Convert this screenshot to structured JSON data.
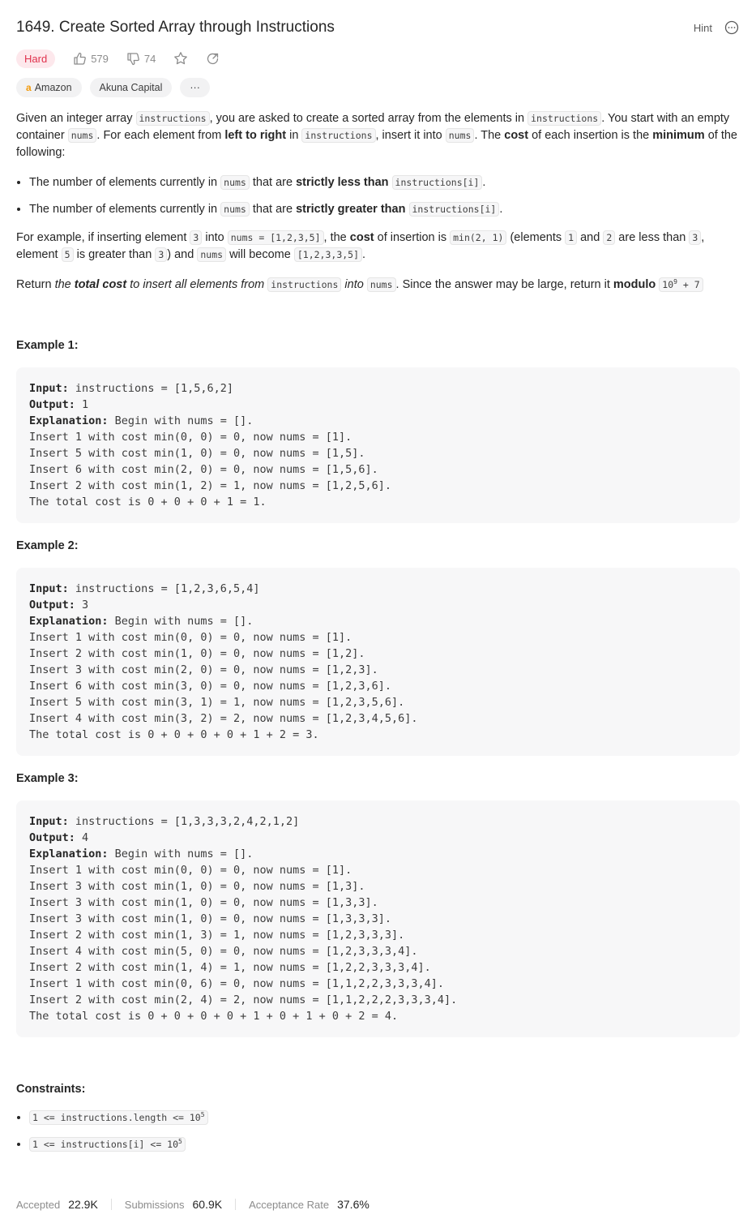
{
  "problem": {
    "title": "1649. Create Sorted Array through Instructions",
    "hint_label": "Hint",
    "difficulty": "Hard",
    "likes": "579",
    "dislikes": "74"
  },
  "tags": {
    "company1": "Amazon",
    "company2": "Akuna Capital",
    "more": "···"
  },
  "description": {
    "p1_a": "Given an integer array ",
    "p1_code1": "instructions",
    "p1_b": ", you are asked to create a sorted array from the elements in ",
    "p1_code2": "instructions",
    "p1_c": ". You start with an empty container ",
    "p1_code3": "nums",
    "p1_d": ". For each element from ",
    "p1_bold1": "left to right",
    "p1_e": " in ",
    "p1_code4": "instructions",
    "p1_f": ", insert it into ",
    "p1_code5": "nums",
    "p1_g": ". The ",
    "p1_bold2": "cost",
    "p1_h": " of each insertion is the ",
    "p1_bold3": "minimum",
    "p1_i": " of the following:",
    "b1_a": "The number of elements currently in ",
    "b1_code1": "nums",
    "b1_b": " that are ",
    "b1_bold": "strictly less than",
    "b1_code2": "instructions[i]",
    "b1_c": ".",
    "b2_a": "The number of elements currently in ",
    "b2_code1": "nums",
    "b2_b": " that are ",
    "b2_bold": "strictly greater than",
    "b2_code2": "instructions[i]",
    "b2_c": ".",
    "p2_a": "For example, if inserting element ",
    "p2_code1": "3",
    "p2_b": " into ",
    "p2_code2": "nums = [1,2,3,5]",
    "p2_c": ", the ",
    "p2_bold": "cost",
    "p2_d": " of insertion is ",
    "p2_code3": "min(2, 1)",
    "p2_e": " (elements ",
    "p2_code4": "1",
    "p2_f": " and ",
    "p2_code5": "2",
    "p2_g": " are less than ",
    "p2_code6": "3",
    "p2_h": ", element ",
    "p2_code7": "5",
    "p2_i": " is greater than ",
    "p2_code8": "3",
    "p2_j": ") and ",
    "p2_code9": "nums",
    "p2_k": " will become ",
    "p2_code10": "[1,2,3,3,5]",
    "p2_l": ".",
    "p3_a": "Return ",
    "p3_i1": "the ",
    "p3_bi": "total cost",
    "p3_i2": " to insert all elements from ",
    "p3_code1": "instructions",
    "p3_i3": " into ",
    "p3_code2": "nums",
    "p3_b": ". Since the answer may be large, return it ",
    "p3_bold": "modulo",
    "p3_code3a": "10",
    "p3_code3sup": "9",
    "p3_code3b": " + 7"
  },
  "examples": [
    {
      "title": "Example 1:",
      "input_label": "Input:",
      "input": " instructions = [1,5,6,2]",
      "output_label": "Output:",
      "output": " 1",
      "explanation_label": "Explanation:",
      "explanation": " Begin with nums = [].\nInsert 1 with cost min(0, 0) = 0, now nums = [1].\nInsert 5 with cost min(1, 0) = 0, now nums = [1,5].\nInsert 6 with cost min(2, 0) = 0, now nums = [1,5,6].\nInsert 2 with cost min(1, 2) = 1, now nums = [1,2,5,6].\nThe total cost is 0 + 0 + 0 + 1 = 1."
    },
    {
      "title": "Example 2:",
      "input_label": "Input:",
      "input": " instructions = [1,2,3,6,5,4]",
      "output_label": "Output:",
      "output": " 3",
      "explanation_label": "Explanation:",
      "explanation": " Begin with nums = [].\nInsert 1 with cost min(0, 0) = 0, now nums = [1].\nInsert 2 with cost min(1, 0) = 0, now nums = [1,2].\nInsert 3 with cost min(2, 0) = 0, now nums = [1,2,3].\nInsert 6 with cost min(3, 0) = 0, now nums = [1,2,3,6].\nInsert 5 with cost min(3, 1) = 1, now nums = [1,2,3,5,6].\nInsert 4 with cost min(3, 2) = 2, now nums = [1,2,3,4,5,6].\nThe total cost is 0 + 0 + 0 + 0 + 1 + 2 = 3."
    },
    {
      "title": "Example 3:",
      "input_label": "Input:",
      "input": " instructions = [1,3,3,3,2,4,2,1,2]",
      "output_label": "Output:",
      "output": " 4",
      "explanation_label": "Explanation:",
      "explanation": " Begin with nums = [].\nInsert 1 with cost min(0, 0) = 0, now nums = [1].\nInsert 3 with cost min(1, 0) = 0, now nums = [1,3].\nInsert 3 with cost min(1, 0) = 0, now nums = [1,3,3].\nInsert 3 with cost min(1, 0) = 0, now nums = [1,3,3,3].\nInsert 2 with cost min(1, 3) = 1, now nums = [1,2,3,3,3].\nInsert 4 with cost min(5, 0) = 0, now nums = [1,2,3,3,3,4].\nInsert 2 with cost min(1, 4) = 1, now nums = [1,2,2,3,3,3,4].\nInsert 1 with cost min(0, 6) = 0, now nums = [1,1,2,2,3,3,3,4].\nInsert 2 with cost min(2, 4) = 2, now nums = [1,1,2,2,2,3,3,3,4].\nThe total cost is 0 + 0 + 0 + 0 + 1 + 0 + 1 + 0 + 2 = 4."
    }
  ],
  "constraints": {
    "title": "Constraints:",
    "c1_a": "1 <= instructions.length <= 10",
    "c1_sup": "5",
    "c2_a": "1 <= instructions[i] <= 10",
    "c2_sup": "5"
  },
  "footer": {
    "accepted_label": "Accepted",
    "accepted_value": "22.9K",
    "submissions_label": "Submissions",
    "submissions_value": "60.9K",
    "rate_label": "Acceptance Rate",
    "rate_value": "37.6%"
  },
  "colors": {
    "hard_text": "#e0324d",
    "hard_bg": "#fde8ec",
    "amazon": "#f29a0a"
  }
}
